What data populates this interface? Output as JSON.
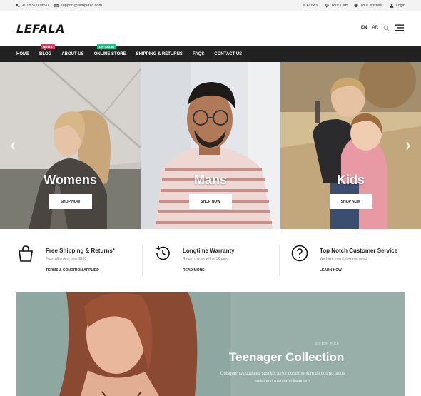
{
  "topbar": {
    "phone": "+018 900 0690",
    "email": "support@templaza.com",
    "currency": "€ EUR $",
    "cart": "Your Cart",
    "wishlist": "Your Wishlist",
    "login": "Login"
  },
  "header": {
    "logo": "LEFALA",
    "lang_en": "EN",
    "lang_ar": "AR"
  },
  "nav": {
    "items": [
      {
        "label": "HOME"
      },
      {
        "label": "BLOG",
        "badge": "NEWS"
      },
      {
        "label": "ABOUT US"
      },
      {
        "label": "ONLINE STORE",
        "badge": "ON SALE!"
      },
      {
        "label": "SHIPPING & RETURNS"
      },
      {
        "label": "FAQS"
      },
      {
        "label": "CONTACT US"
      }
    ]
  },
  "hero": {
    "panels": [
      {
        "title": "Womens",
        "button": "SHOP NOW"
      },
      {
        "title": "Mans",
        "button": "SHOP NOW"
      },
      {
        "title": "Kids",
        "button": "SHOP NOW"
      }
    ],
    "prev_icon": "chevron-left-icon",
    "next_icon": "chevron-right-icon"
  },
  "features": [
    {
      "icon": "shopping-bag-icon",
      "title": "Free Shipping & Returns*",
      "subtitle": "From all orders over $100",
      "link": "TERMS & CONDITION APPLIED"
    },
    {
      "icon": "history-clock-icon",
      "title": "Longtime Warranty",
      "subtitle": "Return money within 30 days",
      "link": "READ MORE"
    },
    {
      "icon": "question-circle-icon",
      "title": "Top Notch Customer Service",
      "subtitle": "We have everything you need",
      "link": "LEARN HOW"
    }
  ],
  "banner": {
    "pretitle": "EDITOR PICK",
    "title": "Teenager Collection",
    "description": "Quisquemos sodales suscipit tortor condimentum de cosmo lacus meleifend menean bibendum."
  },
  "colors": {
    "nav_bg": "#222222",
    "badge_news": "#e5365e",
    "badge_sale": "#1dbf8a",
    "banner_bg": "#8aa39d"
  }
}
